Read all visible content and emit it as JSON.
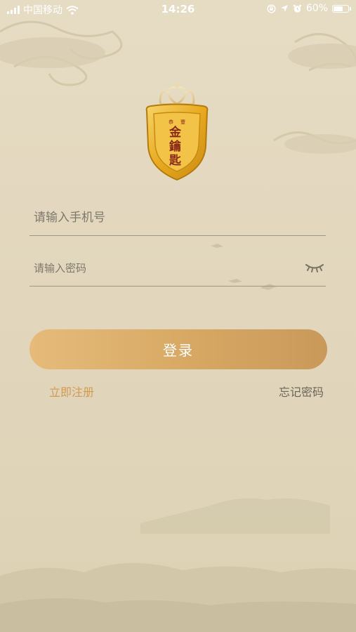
{
  "status_bar": {
    "carrier": "中国移动",
    "time": "14:26",
    "battery": "60%",
    "battery_level": 0.6,
    "icons": [
      "signal-icon",
      "wifi-icon",
      "screen-lock-icon",
      "location-arrow-icon",
      "alarm-clock-icon",
      "battery-icon"
    ]
  },
  "logo": {
    "small_text": "恭 豐",
    "main_text": "金鑰匙",
    "colors": {
      "gold": "#e8b33a",
      "red": "#8a2a16"
    }
  },
  "form": {
    "phone_placeholder": "请输入手机号",
    "password_placeholder": "请输入密码",
    "password_toggle_icon": "eye-closed-icon",
    "login_label": "登录",
    "register_label": "立即注册",
    "forgot_label": "忘记密码"
  },
  "colors": {
    "background": "#e2d7bd",
    "button_start": "#e6bb7a",
    "button_end": "#c9995a",
    "register_link": "#d19a52",
    "forgot_link": "#6b665b"
  }
}
